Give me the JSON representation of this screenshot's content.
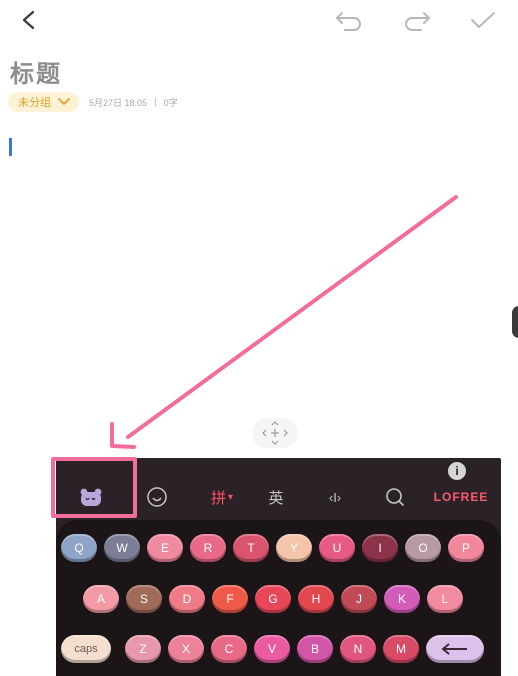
{
  "note": {
    "title": "标题",
    "category": "未分组",
    "date": "5月27日 18:05",
    "separator": "|",
    "word_count": "0字"
  },
  "colors": {
    "category_bg": "#fdf2d5",
    "category_text": "#e0a526",
    "cursor": "#3a78d6",
    "annotation": "#f36d9c",
    "keyboard_bg": "#2a2226"
  },
  "icons": [
    "back-arrow-icon",
    "undo-icon",
    "redo-icon",
    "checkmark-icon",
    "chevron-down-icon",
    "move-handle-icon",
    "du-bear-icon",
    "emoji-icon",
    "cursor-bracket-icon",
    "search-icon",
    "info-icon",
    "backspace-icon"
  ],
  "keyboard": {
    "toolbar": {
      "pinyin": "拼",
      "english": "英",
      "cursor": "‹I›",
      "brand": "LOFREE"
    },
    "rows": [
      [
        {
          "label": "Q",
          "color": "#8fa4c6"
        },
        {
          "label": "W",
          "color": "#7b7f95"
        },
        {
          "label": "E",
          "color": "#f08aa0"
        },
        {
          "label": "R",
          "color": "#e96a87"
        },
        {
          "label": "T",
          "color": "#d9546d"
        },
        {
          "label": "Y",
          "color": "#f4c5a8"
        },
        {
          "label": "U",
          "color": "#e85a86"
        },
        {
          "label": "I",
          "color": "#8b3348"
        },
        {
          "label": "O",
          "color": "#b79aa3"
        },
        {
          "label": "P",
          "color": "#f2879c"
        }
      ],
      [
        {
          "label": "A",
          "color": "#f29aa5"
        },
        {
          "label": "S",
          "color": "#a26a58"
        },
        {
          "label": "D",
          "color": "#ee7b86"
        },
        {
          "label": "F",
          "color": "#ee5a47"
        },
        {
          "label": "G",
          "color": "#e8475a"
        },
        {
          "label": "H",
          "color": "#e2484e"
        },
        {
          "label": "J",
          "color": "#c04a56"
        },
        {
          "label": "K",
          "color": "#d25cb8"
        },
        {
          "label": "L",
          "color": "#f28aa0"
        }
      ],
      [
        {
          "label": "caps",
          "color": "#f4dfcf",
          "wide": true
        },
        {
          "label": "Z",
          "color": "#e798aa"
        },
        {
          "label": "X",
          "color": "#ee8299"
        },
        {
          "label": "C",
          "color": "#e86a86"
        },
        {
          "label": "V",
          "color": "#ea5ca0"
        },
        {
          "label": "B",
          "color": "#d256a8"
        },
        {
          "label": "N",
          "color": "#e0567f"
        },
        {
          "label": "M",
          "color": "#d94a67"
        },
        {
          "label": "",
          "color": "#dcc1ea",
          "back": true,
          "icon": "backspace-icon"
        }
      ]
    ]
  }
}
